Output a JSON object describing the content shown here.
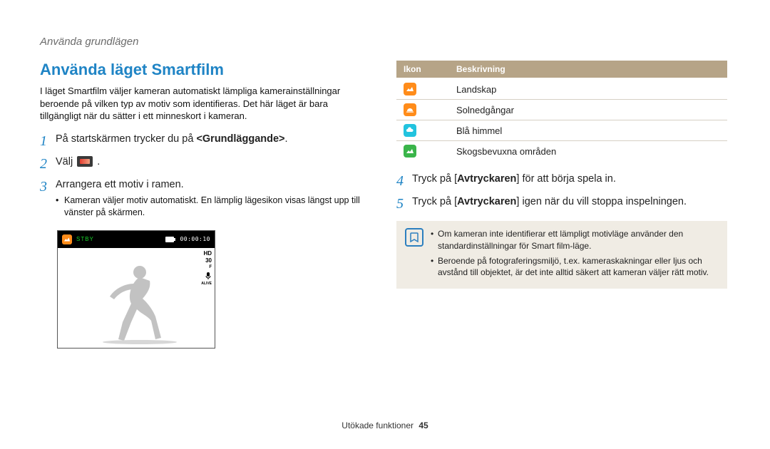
{
  "breadcrumb": "Använda grundlägen",
  "title": "Använda läget Smartfilm",
  "intro": "I läget Smartfilm väljer kameran automatiskt lämpliga kamerainställningar beroende på vilken typ av motiv som identifieras. Det här läget är bara tillgängligt när du sätter i ett minneskort i kameran.",
  "steps_left": {
    "s1_prefix": "På startskärmen trycker du på ",
    "s1_bold": "<Grundläggande>",
    "s1_suffix": ".",
    "s2": "Välj ",
    "s2_suffix": ".",
    "s3": "Arrangera ett motiv i ramen.",
    "s3_bullet": "Kameran väljer motiv automatiskt. En lämplig lägesikon visas längst upp till vänster på skärmen."
  },
  "steps_right": {
    "s4_prefix": "Tryck på [",
    "s4_bold": "Avtryckaren",
    "s4_suffix": "] för att börja spela in.",
    "s5_prefix": "Tryck på [",
    "s5_bold": "Avtryckaren",
    "s5_suffix": "] igen när du vill stoppa inspelningen."
  },
  "preview": {
    "stby": "STBY",
    "time": "00:00:10",
    "hd": "HD",
    "fps": "30",
    "fps_sub": "F",
    "mic": "ALIVE"
  },
  "table": {
    "head_icon": "Ikon",
    "head_desc": "Beskrivning",
    "rows": [
      {
        "icon": "landscape",
        "color": "ic-orange",
        "desc": "Landskap"
      },
      {
        "icon": "sunset",
        "color": "ic-orange",
        "desc": "Solnedgångar"
      },
      {
        "icon": "sky",
        "color": "ic-cyan",
        "desc": "Blå himmel"
      },
      {
        "icon": "forest",
        "color": "ic-green",
        "desc": "Skogsbevuxna områden"
      }
    ]
  },
  "note": {
    "n1": "Om kameran inte identifierar ett lämpligt motivläge använder den standardinställningar för Smart film-läge.",
    "n2": "Beroende på fotograferingsmiljö, t.ex. kameraskakningar eller ljus och avstånd till objektet, är det inte alltid säkert att kameran väljer rätt motiv."
  },
  "footer": {
    "label": "Utökade funktioner",
    "page": "45"
  }
}
